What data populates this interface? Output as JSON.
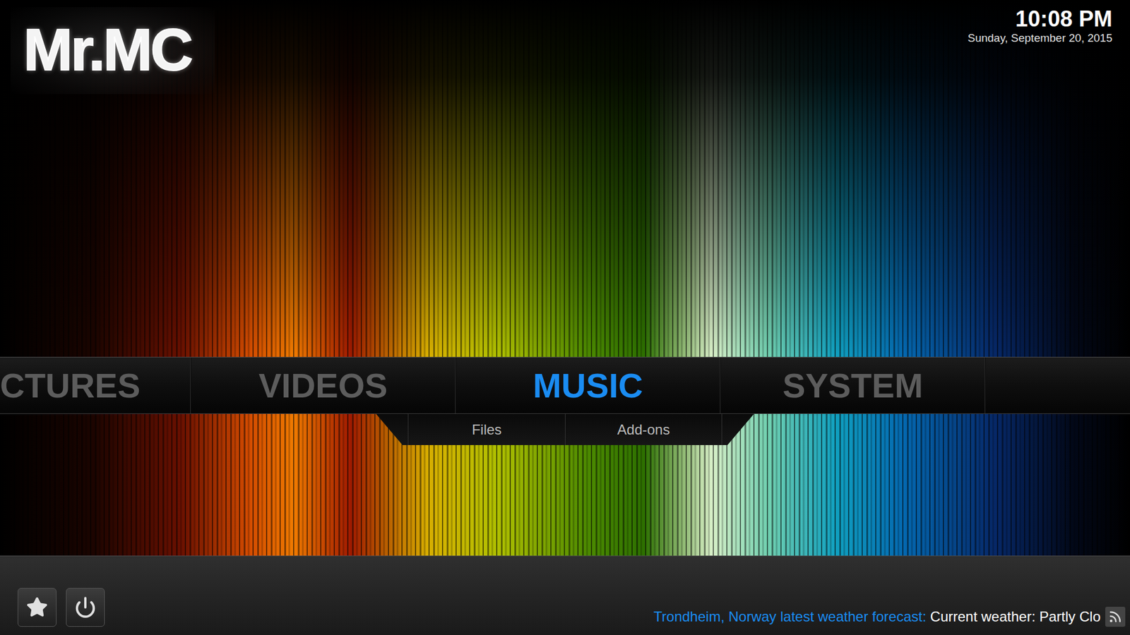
{
  "logo": {
    "text": "Mr.MC"
  },
  "clock": {
    "time": "10:08 PM",
    "date": "Sunday, September 20, 2015"
  },
  "main_menu": [
    {
      "label": "CTURES",
      "selected": false,
      "kind": "clipped"
    },
    {
      "label": "VIDEOS",
      "selected": false,
      "kind": "full"
    },
    {
      "label": "MUSIC",
      "selected": true,
      "kind": "full"
    },
    {
      "label": "SYSTEM",
      "selected": false,
      "kind": "full"
    }
  ],
  "sub_menu": [
    {
      "label": "Files"
    },
    {
      "label": "Add-ons"
    }
  ],
  "ticker": {
    "source": "Trondheim, Norway latest weather forecast:",
    "text": "Current weather: Partly Clo"
  }
}
